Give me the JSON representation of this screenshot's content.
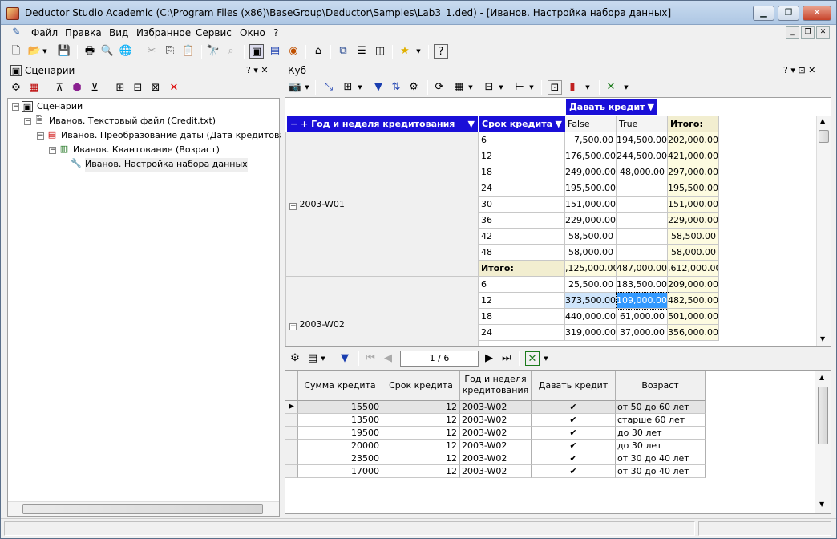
{
  "window": {
    "title": "Deductor Studio Academic (C:\\Program Files (x86)\\BaseGroup\\Deductor\\Samples\\Lab3_1.ded) - [Иванов. Настройка набора данных]",
    "minimize": "▁",
    "restore": "❐",
    "close": "✕"
  },
  "menu": {
    "items": [
      "Файл",
      "Правка",
      "Вид",
      "Избранное",
      "Сервис",
      "Окно",
      "?"
    ]
  },
  "scenarios_panel": {
    "title": "Сценарии",
    "ctrl": "? ▾ ✕",
    "tree": [
      {
        "label": "Сценарии",
        "level": 0,
        "icon": "scenarios-icon"
      },
      {
        "label": "Иванов. Текстовый файл (Credit.txt)",
        "level": 1,
        "icon": "text-file-icon"
      },
      {
        "label": "Иванов. Преобразование даты (Дата кредитования: Г",
        "level": 2,
        "icon": "date-transform-icon"
      },
      {
        "label": "Иванов. Квантование (Возраст)",
        "level": 3,
        "icon": "quantization-icon"
      },
      {
        "label": "Иванов. Настройка набора данных",
        "level": 4,
        "icon": "wrench-icon"
      }
    ]
  },
  "cube_panel": {
    "title": "Куб",
    "ctrl": "? ▾ ⊡ ✕",
    "column_dim": "Давать кредит",
    "row_dim1": "Год и неделя кредитования",
    "row_dim2": "Срок кредита",
    "col_headers": [
      "False",
      "True",
      "Итого:"
    ],
    "groups": [
      {
        "label": "2003-W01",
        "rows": [
          {
            "term": "6",
            "false": "7,500.00",
            "true": "194,500.00",
            "total": "202,000.00"
          },
          {
            "term": "12",
            "false": "176,500.00",
            "true": "244,500.00",
            "total": "421,000.00"
          },
          {
            "term": "18",
            "false": "249,000.00",
            "true": "48,000.00",
            "total": "297,000.00"
          },
          {
            "term": "24",
            "false": "195,500.00",
            "true": "",
            "total": "195,500.00"
          },
          {
            "term": "30",
            "false": "151,000.00",
            "true": "",
            "total": "151,000.00"
          },
          {
            "term": "36",
            "false": "229,000.00",
            "true": "",
            "total": "229,000.00"
          },
          {
            "term": "42",
            "false": "58,500.00",
            "true": "",
            "total": "58,500.00"
          },
          {
            "term": "48",
            "false": "58,000.00",
            "true": "",
            "total": "58,000.00"
          },
          {
            "term": "Итого:",
            "false": ",125,000.00",
            "true": "487,000.00",
            "total": ",612,000.00"
          }
        ]
      },
      {
        "label": "2003-W02",
        "rows": [
          {
            "term": "6",
            "false": "25,500.00",
            "true": "183,500.00",
            "total": "209,000.00"
          },
          {
            "term": "12",
            "false": "373,500.00",
            "true": "109,000.00",
            "total": "482,500.00"
          },
          {
            "term": "18",
            "false": "440,000.00",
            "true": "61,000.00",
            "total": "501,000.00"
          },
          {
            "term": "24",
            "false": "319,000.00",
            "true": "37,000.00",
            "total": "356,000.00"
          }
        ]
      }
    ]
  },
  "detail": {
    "page": "1 / 6",
    "columns": [
      "Сумма кредита",
      "Срок кредита",
      "Год и неделя кредитования",
      "Давать кредит",
      "Возраст"
    ],
    "rows": [
      {
        "sum": "15500",
        "term": "12",
        "week": "2003-W02",
        "give": "✔",
        "age": "от 50 до 60 лет"
      },
      {
        "sum": "13500",
        "term": "12",
        "week": "2003-W02",
        "give": "✔",
        "age": "старше 60 лет"
      },
      {
        "sum": "19500",
        "term": "12",
        "week": "2003-W02",
        "give": "✔",
        "age": "до 30 лет"
      },
      {
        "sum": "20000",
        "term": "12",
        "week": "2003-W02",
        "give": "✔",
        "age": "до 30 лет"
      },
      {
        "sum": "23500",
        "term": "12",
        "week": "2003-W02",
        "give": "✔",
        "age": "от 30 до 40 лет"
      },
      {
        "sum": "17000",
        "term": "12",
        "week": "2003-W02",
        "give": "✔",
        "age": "от 30 до 40 лет"
      }
    ]
  }
}
